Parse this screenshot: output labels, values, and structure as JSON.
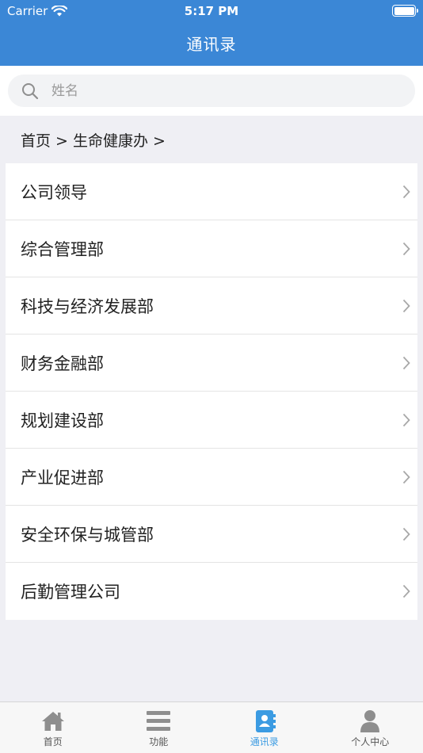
{
  "status_bar": {
    "carrier": "Carrier",
    "time": "5:17 PM"
  },
  "nav": {
    "title": "通讯录"
  },
  "search": {
    "placeholder": "姓名"
  },
  "breadcrumb": {
    "text": "首页 > 生命健康办 >"
  },
  "departments": [
    "公司领导",
    "综合管理部",
    "科技与经济发展部",
    "财务金融部",
    "规划建设部",
    "产业促进部",
    "安全环保与城管部",
    "后勤管理公司"
  ],
  "tabs": [
    {
      "label": "首页",
      "icon": "home-icon"
    },
    {
      "label": "功能",
      "icon": "menu-icon"
    },
    {
      "label": "通讯录",
      "icon": "contacts-icon",
      "active": true
    },
    {
      "label": "个人中心",
      "icon": "person-icon"
    }
  ],
  "colors": {
    "primary": "#3b87d6",
    "active_tab": "#3b9be2",
    "inactive_icon": "#8e8e8e"
  }
}
